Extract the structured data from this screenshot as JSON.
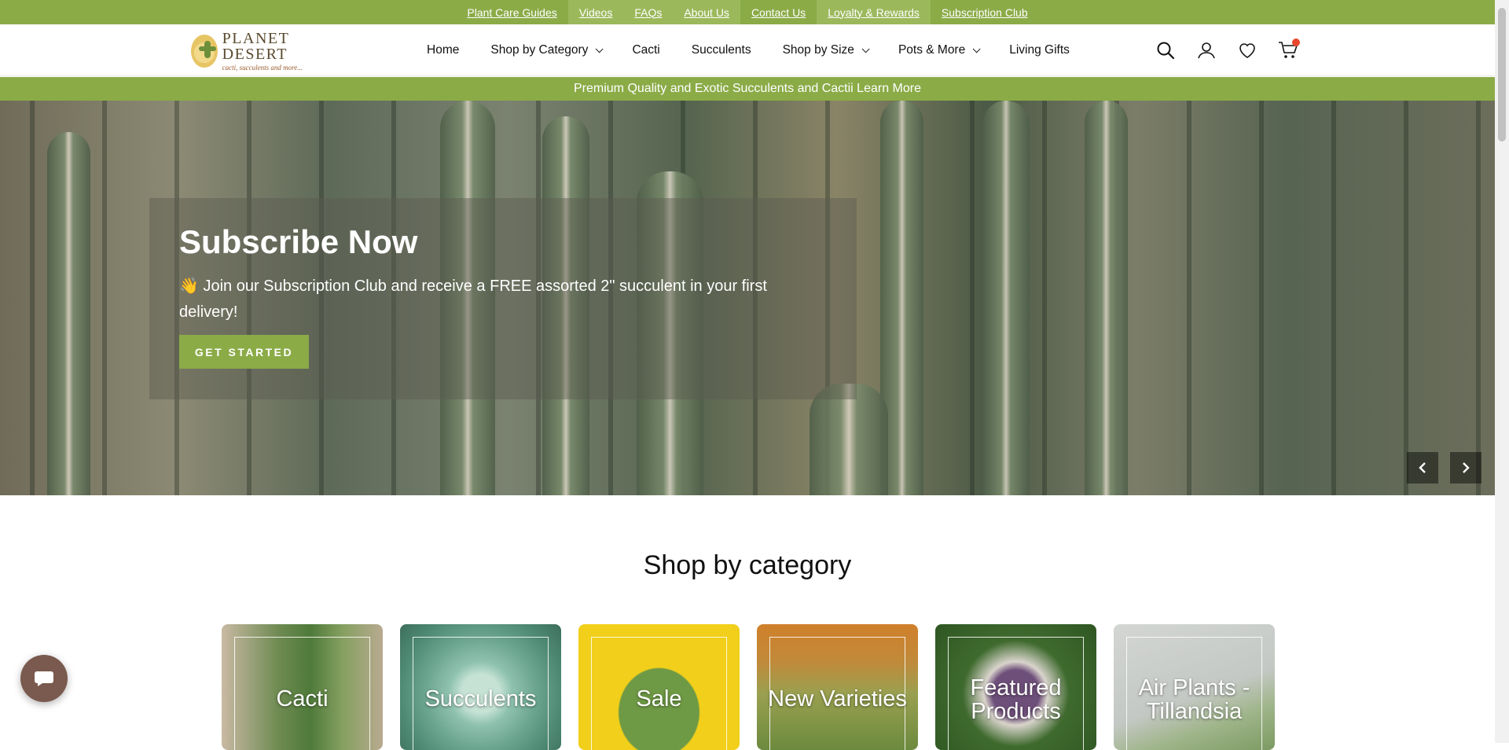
{
  "utility_links": [
    {
      "label": "Plant Care Guides"
    },
    {
      "label": "Videos"
    },
    {
      "label": "FAQs"
    },
    {
      "label": "About Us"
    },
    {
      "label": "Contact Us"
    },
    {
      "label": "Loyalty & Rewards"
    },
    {
      "label": "Subscription Club"
    }
  ],
  "logo": {
    "title": "PLANET DESERT",
    "tagline": "cacti, succulents and more..."
  },
  "nav": [
    {
      "label": "Home"
    },
    {
      "label": "Shop by Category"
    },
    {
      "label": "Cacti"
    },
    {
      "label": "Succulents"
    },
    {
      "label": "Shop by Size"
    },
    {
      "label": "Pots & More"
    },
    {
      "label": "Living Gifts"
    }
  ],
  "announcement": {
    "text": "Premium Quality and Exotic Succulents and Cactii",
    "link": "Learn More"
  },
  "hero": {
    "title": "Subscribe Now",
    "text": "👋 Join our Subscription Club and receive a FREE assorted 2\" succulent in your first delivery!",
    "button": "GET STARTED"
  },
  "categories_section": {
    "title": "Shop by category",
    "items": [
      {
        "label": "Cacti"
      },
      {
        "label": "Succulents"
      },
      {
        "label": "Sale"
      },
      {
        "label": "New Varieties"
      },
      {
        "label": "Featured Products"
      },
      {
        "label": "Air Plants - Tillandsia"
      }
    ]
  },
  "colors": {
    "brand_green": "#8bab47",
    "cart_badge": "#e8472b",
    "chat_button": "#7a5a4e"
  },
  "icons": [
    "search-icon",
    "account-icon",
    "wishlist-icon",
    "cart-icon",
    "chevron-left-icon",
    "chevron-right-icon",
    "chat-icon"
  ]
}
